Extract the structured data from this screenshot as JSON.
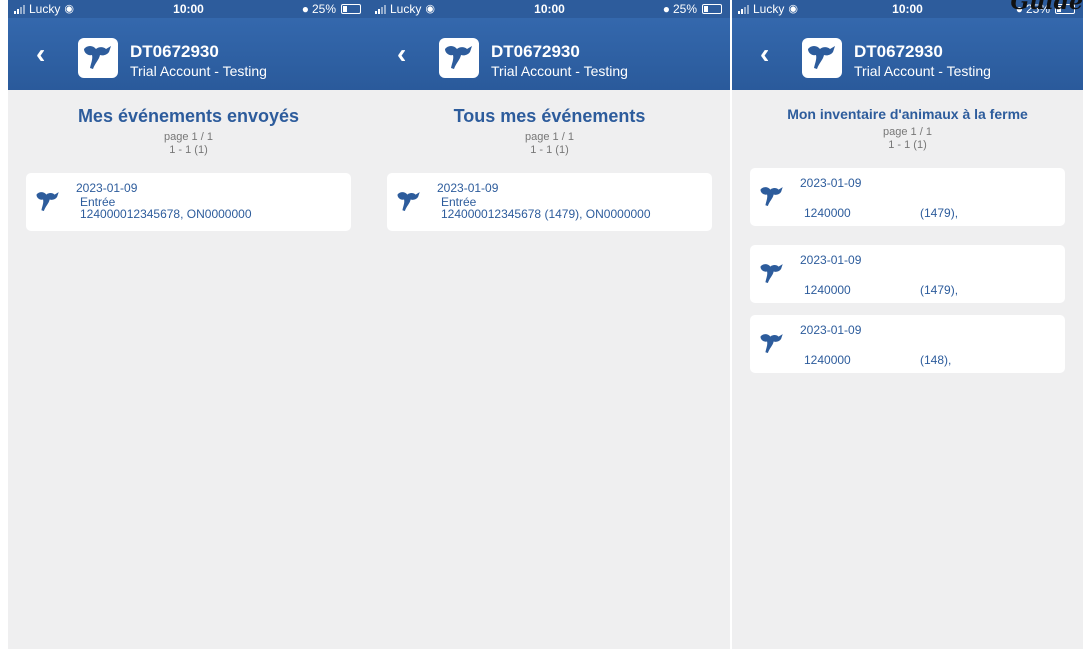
{
  "corner_label": "Guide",
  "status": {
    "carrier": "Lucky",
    "time": "10:00",
    "battery": "25%"
  },
  "header": {
    "title": "DT0672930",
    "subtitle": "Trial Account - Testing"
  },
  "screens": [
    {
      "title": "Mes événements envoyés",
      "page": "page 1 / 1",
      "range": "1 - 1 (1)",
      "events": [
        {
          "date": "2023-01-09",
          "type": "Entrée",
          "id": "124000012345678, ON0000000"
        }
      ]
    },
    {
      "title": "Tous mes événements",
      "page": "page 1 / 1",
      "range": "1 - 1 (1)",
      "events": [
        {
          "date": "2023-01-09",
          "type": "Entrée",
          "id": "124000012345678 (1479), ON0000000"
        }
      ]
    },
    {
      "title": "Mon inventaire d'animaux à la ferme",
      "page": "page 1 / 1",
      "range": "1 - 1 (1)",
      "animals": [
        {
          "date": "2023-01-09",
          "code": "1240000",
          "num": "(1479),"
        },
        {
          "date": "2023-01-09",
          "code": "1240000",
          "num": "(1479),"
        },
        {
          "date": "2023-01-09",
          "code": "1240000",
          "num": "(148),"
        }
      ]
    }
  ],
  "colors": {
    "header": "#2d5c9c",
    "accent": "#2d5c9c",
    "background": "#efeff0"
  },
  "icons": {
    "back": "chevron-left-icon",
    "logo": "cow-logo-icon",
    "card": "cow-icon"
  }
}
